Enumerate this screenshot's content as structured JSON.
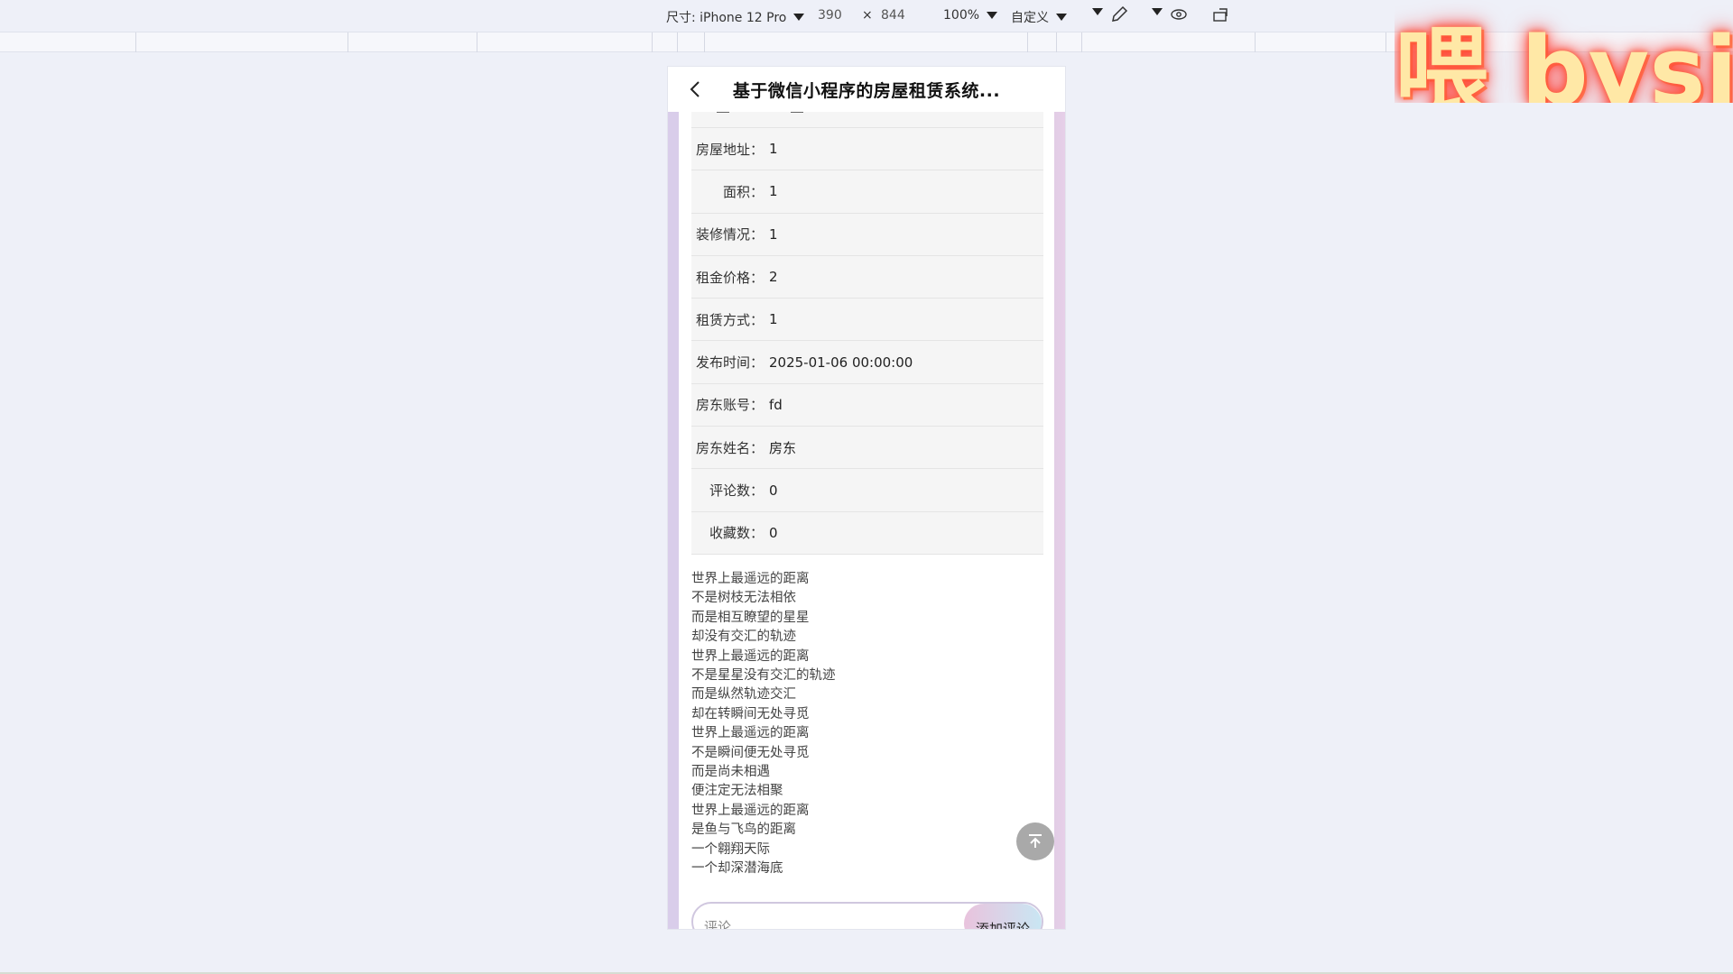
{
  "devtools": {
    "device_label": "尺寸: iPhone 12 Pro",
    "width": "390",
    "times": "×",
    "height": "844",
    "zoom": "100%",
    "custom": "自定义"
  },
  "watermark": "喂 bysj",
  "header": {
    "title": "基于微信小程序的房屋租赁系统..."
  },
  "details": [
    {
      "label": "房屋地址：",
      "value": "1"
    },
    {
      "label": "面积：",
      "value": "1"
    },
    {
      "label": "装修情况：",
      "value": "1"
    },
    {
      "label": "租金价格：",
      "value": "2"
    },
    {
      "label": "租赁方式：",
      "value": "1"
    },
    {
      "label": "发布时间：",
      "value": "2025-01-06 00:00:00"
    },
    {
      "label": "房东账号：",
      "value": "fd"
    },
    {
      "label": "房东姓名：",
      "value": "房东"
    },
    {
      "label": "评论数：",
      "value": "0"
    },
    {
      "label": "收藏数：",
      "value": "0"
    }
  ],
  "poem": [
    "世界上最遥远的距离",
    "不是树枝无法相依",
    "而是相互瞭望的星星",
    "却没有交汇的轨迹",
    "世界上最遥远的距离",
    "不是星星没有交汇的轨迹",
    "而是纵然轨迹交汇",
    "却在转瞬间无处寻觅",
    "世界上最遥远的距离",
    "不是瞬间便无处寻觅",
    "而是尚未相遇",
    "便注定无法相聚",
    "世界上最遥远的距离",
    "是鱼与飞鸟的距离",
    "一个翱翔天际",
    "一个却深潜海底"
  ],
  "comment": {
    "placeholder": "评论",
    "button_label": "添加评论"
  },
  "icons": {
    "back": "chevron-left-icon",
    "to_top": "arrow-up-to-top-icon"
  }
}
